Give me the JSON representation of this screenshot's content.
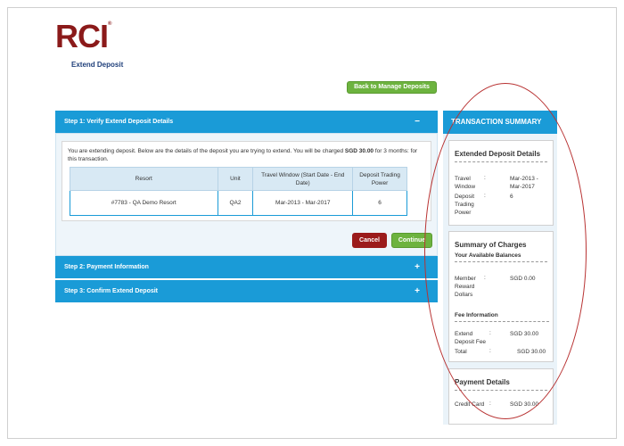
{
  "brand": {
    "logo_text": "RCI",
    "registered": "®"
  },
  "page_title": "Extend Deposit",
  "back_button": "Back to Manage Deposits",
  "step1": {
    "title": "Step 1: Verify Extend Deposit Details",
    "toggle": "−",
    "intro_prefix": "You are extending deposit. Below are the details of the deposit you are trying to extend. You will be charged ",
    "charge": "SGD 30.00",
    "intro_mid": " for ",
    "months": "3",
    "intro_suffix": " months: for this transaction.",
    "table": {
      "headers": [
        "Resort",
        "Unit",
        "Travel Window (Start Date - End Date)",
        "Deposit Trading Power"
      ],
      "rows": [
        [
          "#7783 - QA Demo Resort",
          "QA2",
          "Mar-2013 - Mar-2017",
          "6"
        ]
      ]
    },
    "cancel": "Cancel",
    "continue": "Continue"
  },
  "step2": {
    "title": "Step 2: Payment Information",
    "toggle": "+"
  },
  "step3": {
    "title": "Step 3: Confirm Extend Deposit",
    "toggle": "+"
  },
  "summary": {
    "title": "TRANSACTION SUMMARY",
    "extended": {
      "title": "Extended Deposit Details",
      "travel_window_label": "Travel Window",
      "travel_window_value": "Mar-2013 - Mar-2017",
      "trading_power_label": "Deposit Trading Power",
      "trading_power_value": "6"
    },
    "charges": {
      "title": "Summary of Charges",
      "balances_label": "Your Available Balances",
      "reward_label": "Member Reward Dollars",
      "reward_value": "SGD 0.00",
      "fee_label": "Fee Information",
      "extend_fee_label": "Extend Deposit Fee",
      "extend_fee_value": "SGD 30.00",
      "total_label": "Total",
      "total_value": "SGD 30.00"
    },
    "payment": {
      "title": "Payment Details",
      "method_label": "Credit Card",
      "method_value": "SGD 30.00"
    }
  },
  "colors": {
    "brand_red": "#8b1a1a",
    "step_blue": "#1a9bd7",
    "green": "#6db33f",
    "cancel_red": "#9b1b1b"
  }
}
